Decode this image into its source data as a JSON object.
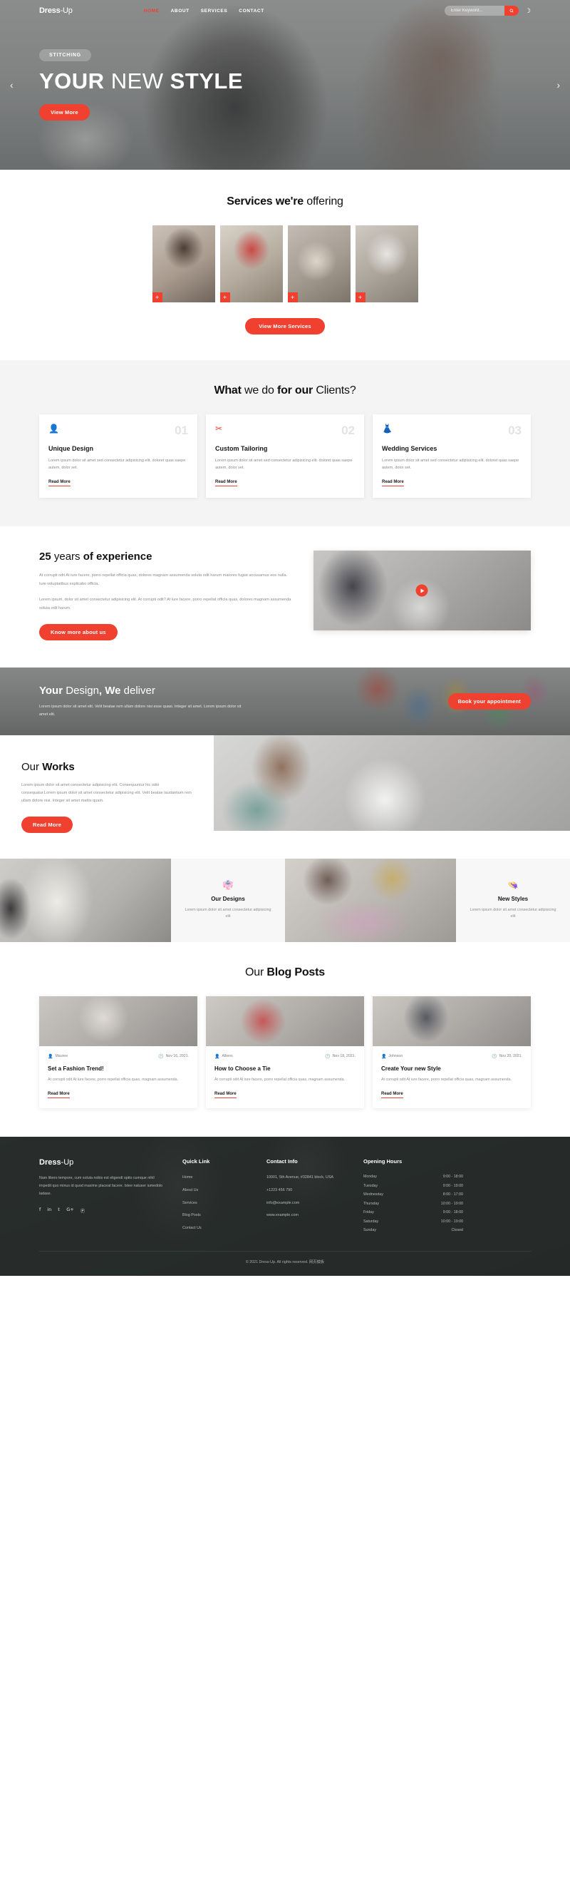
{
  "nav": {
    "logo_bold": "Dress",
    "logo_light": "-Up",
    "links": [
      {
        "label": "HOME",
        "active": true
      },
      {
        "label": "ABOUT",
        "active": false
      },
      {
        "label": "SERVICES",
        "active": false
      },
      {
        "label": "CONTACT",
        "active": false
      }
    ],
    "search_placeholder": "Enter Keyword...",
    "search_value": "",
    "search_icon": "search-icon",
    "theme_icon": "moon-icon"
  },
  "hero": {
    "badge": "STITCHING",
    "title_bold_1": "YOUR",
    "title_light": " NEW ",
    "title_bold_2": "STYLE",
    "button": "View More",
    "prev": "‹",
    "next": "›"
  },
  "services": {
    "title_bold": "Services we're",
    "title_light": " offering",
    "cards": [
      {
        "plus": "+"
      },
      {
        "plus": "+"
      },
      {
        "plus": "+"
      },
      {
        "plus": "+"
      }
    ],
    "more_button": "View More Services"
  },
  "clients": {
    "title_bold_1": "What",
    "title_light_1": " we do ",
    "title_bold_2": "for our",
    "title_light_2": " Clients?",
    "cards": [
      {
        "icon": "person-icon",
        "glyph": "👤",
        "number": "01",
        "title": "Unique Design",
        "text": "Lorem ipsum dolor sit amet sed consectetur adipisicing elit. doloret quas saepe autem, dolor set.",
        "link": "Read More"
      },
      {
        "icon": "scissors-icon",
        "glyph": "✂",
        "number": "02",
        "title": "Custom Tailoring",
        "text": "Lorem ipsum dolor sit amet sed consectetur adipisicing elit. doloret quas saepe autem, dolor set.",
        "link": "Read More"
      },
      {
        "icon": "dress-icon",
        "glyph": "👗",
        "number": "03",
        "title": "Wedding Services",
        "text": "Lorem ipsum dolor sit amet sed consectetur adipisicing elit. doloret quas saepe autem, dolor set.",
        "link": "Read More"
      }
    ]
  },
  "experience": {
    "title_bold_1": "25",
    "title_light": " years ",
    "title_bold_2": "of experience",
    "para1": "At corrupti odit At iure facere, porro repellat officia quas, dolores magnam assumenda soluta odit harum maiores fugiat accusamus eos nulla. Iure voluptatibus explicabo officia.",
    "para2": "Lorem ipsum, dolor sit amet consectetur adipisicing elit. At corrupti odit? At iure facere, porro repellat officia quas, dolores magnam assumenda soluta odit harum.",
    "button": "Know more about us",
    "video_icon": "play-icon"
  },
  "deliver": {
    "title_bold_1": "Your",
    "title_light_1": " Design",
    "title_bold_2": ", We",
    "title_light_2": " deliver",
    "text": "Lorem ipsum dolor sit amet elit. Velit beatae rem ullam dolore nisi esse quasi. Integer sit amet. Lorem ipsum dolor sit amet elit.",
    "button": "Book your appointment"
  },
  "works": {
    "title_light": "Our ",
    "title_bold": "Works",
    "text": "Lorem ipsum dolor sit amet consectetur adipisicing elit. Consequuntur hic odio consequatur.Lorem ipsum dolor sit amet consectetur adipisicing elit. Velit beatae laudantium rem ullam dolore nisi. Integer sit amet mattis quam.",
    "button": "Read More"
  },
  "quad": [
    {
      "icon": "dress-form-icon",
      "glyph": "👘",
      "title": "Our Designs",
      "text": "Lorem ipsum dolor sit amet consectetur adipisicing elit"
    },
    {
      "icon": "hanger-icon",
      "glyph": "👒",
      "title": "New Styles",
      "text": "Lorem ipsum dolor sit amet consectetur adipisicing elit"
    }
  ],
  "blog": {
    "title_light": "Our ",
    "title_bold": "Blog Posts",
    "posts": [
      {
        "author_icon": "user-icon",
        "author": "Mauree",
        "date_icon": "clock-icon",
        "date": "Nov 16, 2021.",
        "title": "Set a Fashion Trend!",
        "text": "At corrupti odit At iure facere, porro repellat officia quas, magnam assumenda.",
        "link": "Read More"
      },
      {
        "author_icon": "user-icon",
        "author": "Alliens",
        "date_icon": "clock-icon",
        "date": "Nov 18, 2021.",
        "title": "How to Choose a Tie",
        "text": "At corrupti odit At iure facere, porro repellat officia quas, magnam assumenda.",
        "link": "Read More"
      },
      {
        "author_icon": "user-icon",
        "author": "Johnson",
        "date_icon": "clock-icon",
        "date": "Nov 20, 2021.",
        "title": "Create Your new Style",
        "text": "At corrupti odit At iure facere, porro repellat officia quas, magnam assumenda.",
        "link": "Read More"
      }
    ]
  },
  "footer": {
    "logo_bold": "Dress",
    "logo_light": "-Up",
    "about": "Nam libero tempore, cum soluta nobis est eligendi optio cumque nihil impedit quo minus id quod maxime placeat facere. Istee natuser iumedolo ladase.",
    "socials": [
      {
        "name": "facebook-icon",
        "glyph": "f"
      },
      {
        "name": "linkedin-icon",
        "glyph": "in"
      },
      {
        "name": "twitter-icon",
        "glyph": "𝕥"
      },
      {
        "name": "google-plus-icon",
        "glyph": "G+"
      },
      {
        "name": "pinterest-icon",
        "glyph": "Ⓟ"
      }
    ],
    "quick_link": {
      "heading": "Quick Link",
      "items": [
        "Home",
        "About Us",
        "Services",
        "Blog Posts",
        "Contact Us"
      ]
    },
    "contact": {
      "heading": "Contact Info",
      "lines": [
        "10001, 5th Avenue, #32841 block, USA",
        "+1223 456 790",
        "info@example.com",
        "www.example.com"
      ]
    },
    "hours": {
      "heading": "Opening Hours",
      "rows": [
        {
          "day": "Monday",
          "time": "9:00 - 18:00"
        },
        {
          "day": "Tuesday",
          "time": "9:00 - 19:00"
        },
        {
          "day": "Wednesday",
          "time": "8:00 - 17:00"
        },
        {
          "day": "Thursday",
          "time": "10:00 - 19:00"
        },
        {
          "day": "Friday",
          "time": "9:00 - 18:00"
        },
        {
          "day": "Saturday",
          "time": "10:00 - 19:00"
        },
        {
          "day": "Sunday",
          "time": "Closed"
        }
      ]
    },
    "copyright": "© 2021 Dress-Up. All rights reserved. 网页模板"
  },
  "colors": {
    "accent": "#f0402f",
    "dark": "#242928",
    "muted": "#8a8a8a"
  }
}
